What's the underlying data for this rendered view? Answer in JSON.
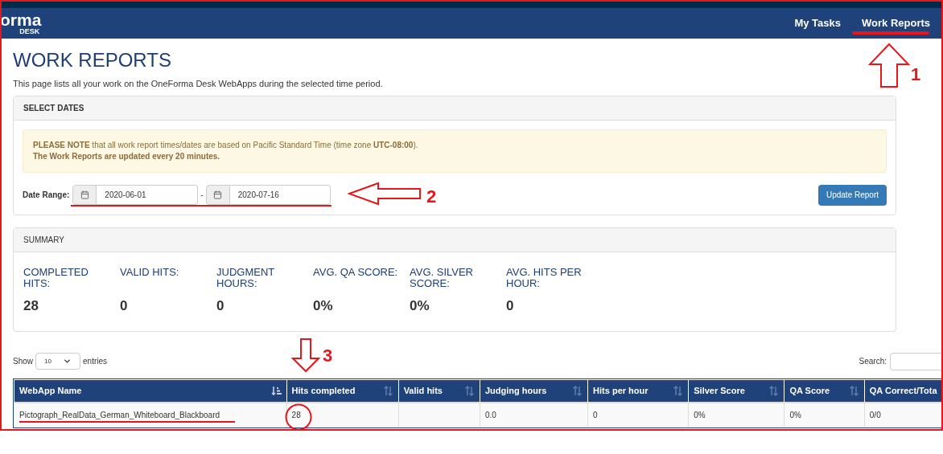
{
  "header": {
    "logo": "orma",
    "logo_sub": "DESK",
    "nav": [
      {
        "label": "My Tasks"
      },
      {
        "label": "Work Reports"
      }
    ]
  },
  "page": {
    "title": "WORK REPORTS",
    "intro": "This page lists all your work on the OneForma Desk WebApps during the selected time period."
  },
  "select_dates": {
    "heading": "SELECT DATES",
    "note_line_1": "**PLEASE NOTE** that all work report times/dates are based on Pacific Standard Time (time zone **UTC-08:00**).",
    "note_line_2": "The Work Reports are updated every 20 minutes.",
    "label": "Date Range:",
    "start": "2020-06-01",
    "separator": "-",
    "end": "2020-07-16",
    "button": "Update Report"
  },
  "summary": {
    "heading": "SUMMARY",
    "stats": [
      {
        "label": "COMPLETED HITS:",
        "value": "28"
      },
      {
        "label": "VALID HITS:",
        "value": "0"
      },
      {
        "label": "JUDGMENT HOURS:",
        "value": "0"
      },
      {
        "label": "AVG. QA SCORE:",
        "value": "0%"
      },
      {
        "label": "AVG. SILVER SCORE:",
        "value": "0%"
      },
      {
        "label": "AVG. HITS PER HOUR:",
        "value": "0"
      }
    ]
  },
  "table_controls": {
    "show": "Show",
    "page_size": "10",
    "entries": "entries",
    "search_label": "Search:"
  },
  "table": {
    "columns": [
      {
        "label": "WebApp Name",
        "sorted": true
      },
      {
        "label": "Hits completed",
        "sorted": false
      },
      {
        "label": "Valid hits",
        "sorted": false
      },
      {
        "label": "Judging hours",
        "sorted": false
      },
      {
        "label": "Hits per hour",
        "sorted": false
      },
      {
        "label": "Silver Score",
        "sorted": false
      },
      {
        "label": "QA Score",
        "sorted": false
      },
      {
        "label": "QA Correct/Tota"
      }
    ],
    "rows": [
      [
        "Pictograph_RealData_German_Whiteboard_Blackboard",
        "28",
        "",
        "0.0",
        "0",
        "0%",
        "0%",
        "0/0"
      ]
    ]
  },
  "annotations": [
    "1",
    "2",
    "3"
  ]
}
